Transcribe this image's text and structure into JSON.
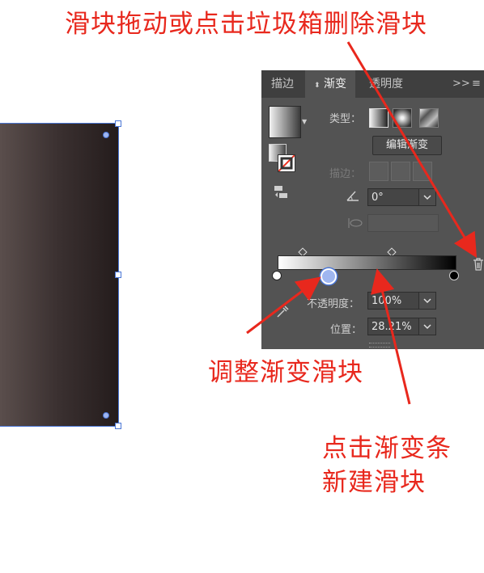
{
  "annotations": {
    "top": "滑块拖动或点击垃圾箱删除滑块",
    "adjust": "调整渐变滑块",
    "create_line1": "点击渐变条",
    "create_line2": "新建滑块"
  },
  "panel": {
    "tabs": [
      {
        "label": "描边",
        "active": false
      },
      {
        "label": "渐变",
        "active": true
      },
      {
        "label": "透明度",
        "active": false
      }
    ],
    "tab_prefix_icon": "updown-arrow-icon",
    "overflow_label": ">>",
    "type_label": "类型：",
    "edit_gradient_label": "编辑渐变",
    "stroke_label": "描边：",
    "angle_value": "0°",
    "opacity_label": "不透明度：",
    "opacity_value": "100%",
    "location_label": "位置：",
    "location_value": "28.21%"
  },
  "gradient": {
    "start_color": "#ffffff",
    "end_color": "#000000",
    "selected_stop_location_pct": 28.21
  },
  "colors": {
    "annotation": "#e8281d",
    "panel_bg": "#535353",
    "selection_blue": "#4a76d6"
  }
}
